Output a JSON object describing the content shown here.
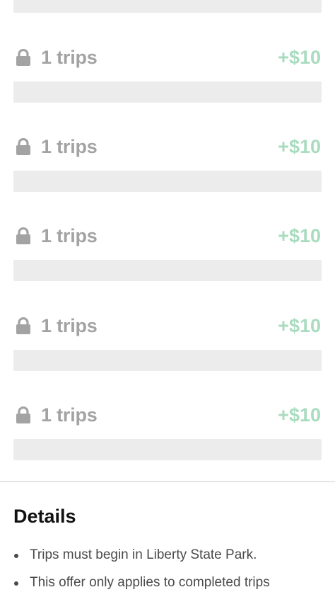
{
  "colors": {
    "locked_text": "#a3a3a3",
    "reward_text": "#a9dcbf",
    "progress_track": "#ececec",
    "lock_icon": "#a3a3a3"
  },
  "tiers": [
    {
      "icon": "lock-icon",
      "label": "1 trips",
      "reward": "+$10",
      "progress": 0
    },
    {
      "icon": "lock-icon",
      "label": "1 trips",
      "reward": "+$10",
      "progress": 0
    },
    {
      "icon": "lock-icon",
      "label": "1 trips",
      "reward": "+$10",
      "progress": 0
    },
    {
      "icon": "lock-icon",
      "label": "1 trips",
      "reward": "+$10",
      "progress": 0
    },
    {
      "icon": "lock-icon",
      "label": "1 trips",
      "reward": "+$10",
      "progress": 0
    }
  ],
  "top_progress": 0,
  "details": {
    "title": "Details",
    "items": [
      "Trips must begin in Liberty State Park.",
      "This offer only applies to completed trips"
    ]
  }
}
